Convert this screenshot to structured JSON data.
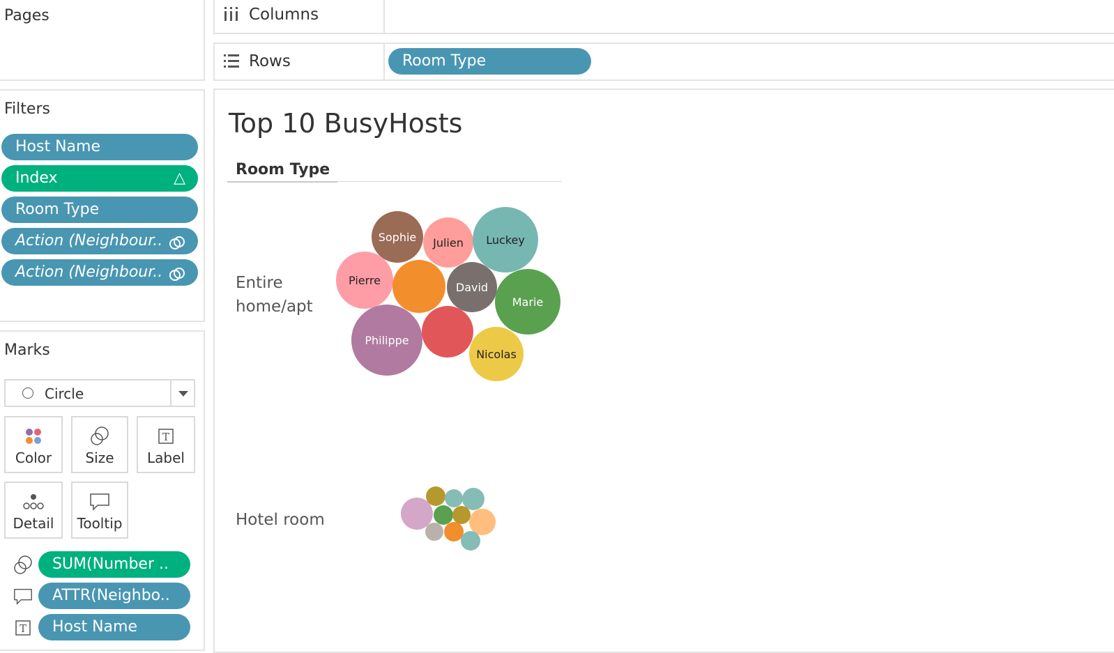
{
  "pages": {
    "title": "Pages"
  },
  "filters": {
    "title": "Filters",
    "items": [
      {
        "label": "Host Name",
        "color": "blue",
        "italic": false,
        "trail": ""
      },
      {
        "label": "Index",
        "color": "green",
        "italic": false,
        "trail": "△"
      },
      {
        "label": "Room Type",
        "color": "blue",
        "italic": false,
        "trail": ""
      },
      {
        "label": "Action (Neighbour..",
        "color": "blue",
        "italic": true,
        "trail": "link"
      },
      {
        "label": "Action (Neighbour..",
        "color": "blue",
        "italic": true,
        "trail": "link"
      }
    ]
  },
  "marks": {
    "title": "Marks",
    "type_select": "Circle",
    "buttons": {
      "color": "Color",
      "size": "Size",
      "label": "Label",
      "detail": "Detail",
      "tooltip": "Tooltip"
    },
    "cards": [
      {
        "icon": "size-icon",
        "label": "SUM(Number ..",
        "color": "green"
      },
      {
        "icon": "tooltip-icon",
        "label": "ATTR(Neighbo..",
        "color": "blue"
      },
      {
        "icon": "label-icon",
        "label": "Host Name",
        "color": "blue"
      }
    ]
  },
  "shelves": {
    "columns_label": "Columns",
    "rows_label": "Rows",
    "rows_pill": "Room Type"
  },
  "view": {
    "title": "Top 10 BusyHosts",
    "row_header": "Room Type",
    "row_label_1": "Entire home/apt",
    "row_label_2": "Hotel room"
  },
  "chart_data": {
    "type": "packed-bubble",
    "title": "Top 10 BusyHosts",
    "row_field": "Room Type",
    "groups": [
      {
        "name": "Entire home/apt",
        "bubbles": [
          {
            "label": "Sophie",
            "color": "#9a6b55",
            "r": 37
          },
          {
            "label": "Julien",
            "color": "#ff9d9a",
            "r": 36
          },
          {
            "label": "Luckey",
            "color": "#76b7b2",
            "r": 47
          },
          {
            "label": "Pierre",
            "color": "#ff9da7",
            "r": 41
          },
          {
            "label": "",
            "color": "#f28e2b",
            "r": 38
          },
          {
            "label": "David",
            "color": "#79706e",
            "r": 36
          },
          {
            "label": "Marie",
            "color": "#59a14f",
            "r": 47
          },
          {
            "label": "Philippe",
            "color": "#b07aa1",
            "r": 51
          },
          {
            "label": "",
            "color": "#e15759",
            "r": 37
          },
          {
            "label": "Nicolas",
            "color": "#edc948",
            "r": 39
          }
        ]
      },
      {
        "name": "Hotel room",
        "bubbles": [
          {
            "label": "",
            "color": "#d4a6c8",
            "r": 23
          },
          {
            "label": "",
            "color": "#b6992d",
            "r": 14
          },
          {
            "label": "",
            "color": "#86bcb6",
            "r": 13
          },
          {
            "label": "",
            "color": "#86bcb6",
            "r": 16
          },
          {
            "label": "",
            "color": "#59a14f",
            "r": 14
          },
          {
            "label": "",
            "color": "#b6992d",
            "r": 13
          },
          {
            "label": "",
            "color": "#ffbe7d",
            "r": 19
          },
          {
            "label": "",
            "color": "#bab0ac",
            "r": 13
          },
          {
            "label": "",
            "color": "#f28e2b",
            "r": 14
          },
          {
            "label": "",
            "color": "#86bcb6",
            "r": 14
          }
        ]
      }
    ]
  }
}
